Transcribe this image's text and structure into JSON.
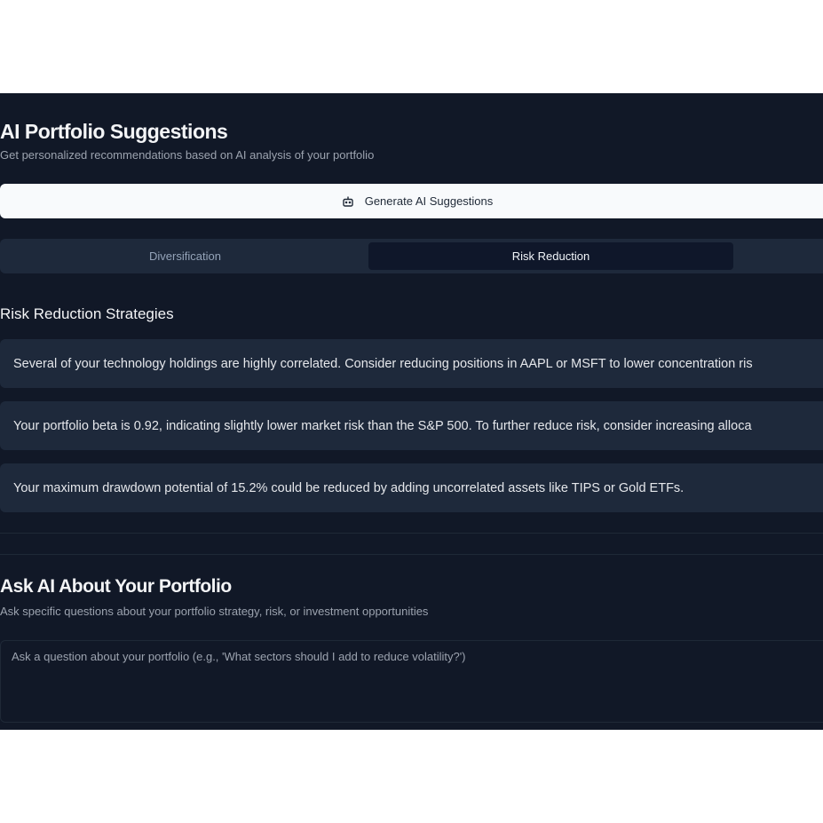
{
  "header": {
    "title": "AI Portfolio Suggestions",
    "subtitle": "Get personalized recommendations based on AI analysis of your portfolio"
  },
  "generate_button": {
    "label": "Generate AI Suggestions",
    "icon": "robot-icon"
  },
  "tabs": [
    {
      "label": "Diversification",
      "active": false
    },
    {
      "label": "Risk Reduction",
      "active": true
    }
  ],
  "section": {
    "title": "Risk Reduction Strategies",
    "items": [
      "Several of your technology holdings are highly correlated. Consider reducing positions in AAPL or MSFT to lower concentration ris",
      "Your portfolio beta is 0.92, indicating slightly lower market risk than the S&P 500. To further reduce risk, consider increasing alloca",
      "Your maximum drawdown potential of 15.2% could be reduced by adding uncorrelated assets like TIPS or Gold ETFs."
    ]
  },
  "ask": {
    "title": "Ask AI About Your Portfolio",
    "subtitle": "Ask specific questions about your portfolio strategy, risk, or investment opportunities",
    "placeholder": "Ask a question about your portfolio (e.g., 'What sectors should I add to reduce volatility?')",
    "value": ""
  },
  "colors": {
    "background": "#111827",
    "card": "#1e293b",
    "button_bg": "#f8fafc",
    "active_tab": "#0f172a"
  }
}
